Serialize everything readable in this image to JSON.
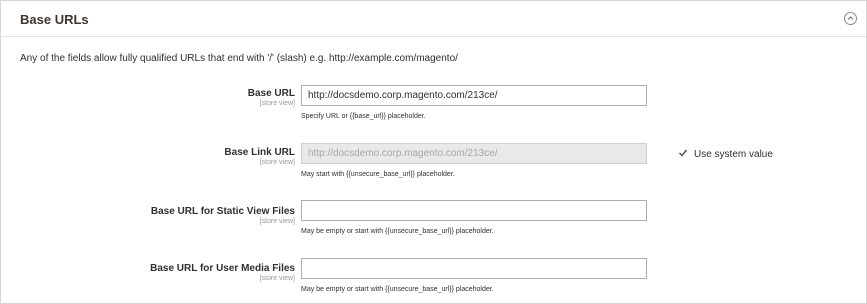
{
  "section": {
    "title": "Base URLs",
    "description": "Any of the fields allow fully qualified URLs that end with '/' (slash) e.g. http://example.com/magento/"
  },
  "fields": [
    {
      "label": "Base URL",
      "scope": "[store view]",
      "value": "http://docsdemo.corp.magento.com/213ce/",
      "note": "Specify URL or {{base_url}} placeholder.",
      "disabled": false
    },
    {
      "label": "Base Link URL",
      "scope": "[store view]",
      "value": "http://docsdemo.corp.magento.com/213ce/",
      "note": "May start with {{unsecure_base_url}} placeholder.",
      "disabled": true,
      "use_system_value": {
        "label": "Use system value",
        "checked": true
      }
    },
    {
      "label": "Base URL for Static View Files",
      "scope": "[store view]",
      "value": "",
      "note": "May be empty or start with {{unsecure_base_url}} placeholder.",
      "disabled": false
    },
    {
      "label": "Base URL for User Media Files",
      "scope": "[store view]",
      "value": "",
      "note": "May be empty or start with {{unsecure_base_url}} placeholder.",
      "disabled": false
    }
  ],
  "icons": {
    "collapse": "chevron-up-circle-icon",
    "checkbox": "check-icon"
  }
}
